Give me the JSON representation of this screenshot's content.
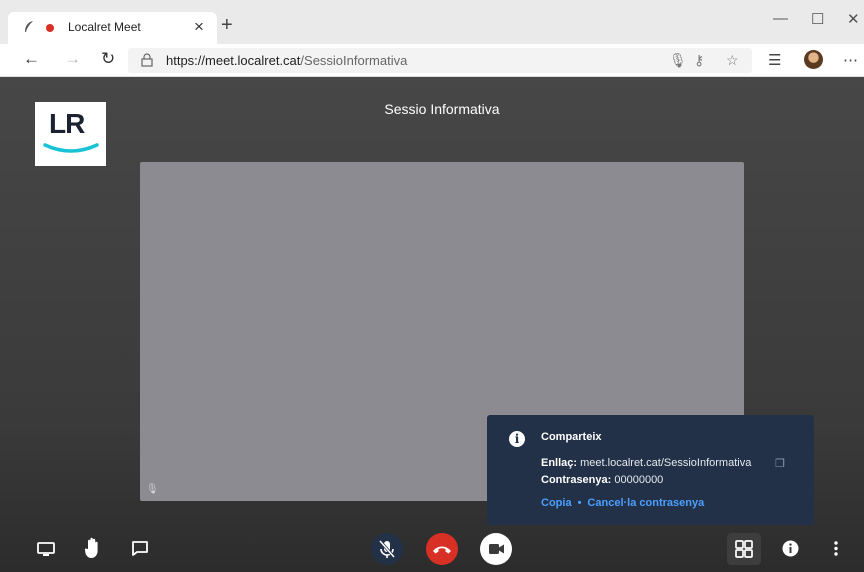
{
  "browser": {
    "tab_title": "Localret Meet",
    "tab_close": "×",
    "new_tab": "+",
    "url_host": "https://meet.localret.cat",
    "url_path": "/SessioInformativa",
    "window_controls": [
      "—",
      "☐",
      "✕"
    ]
  },
  "meeting": {
    "logo_text": "LR",
    "title": "Sessio Informativa"
  },
  "share_popup": {
    "title": "Comparteix",
    "link_label": "Enllaç:",
    "link_value": "meet.localret.cat/SessioInformativa",
    "password_label": "Contrasenya:",
    "password_value": "00000000",
    "copy_action": "Copia",
    "separator": "•",
    "cancel_password_action": "Cancel·la contrasenya"
  },
  "toolbar": {
    "left_icons": [
      "screen-share-icon",
      "raise-hand-icon",
      "chat-icon"
    ],
    "center_icons": [
      "mic-muted-icon",
      "hang-up-icon",
      "camera-icon"
    ],
    "right_icons": [
      "tile-view-icon",
      "info-icon",
      "more-options-icon"
    ]
  },
  "colors": {
    "background": "#404040",
    "hangup": "#d93025",
    "popup": "#233148",
    "link": "#4a9fff",
    "logo_accent": "#19c3d6"
  }
}
